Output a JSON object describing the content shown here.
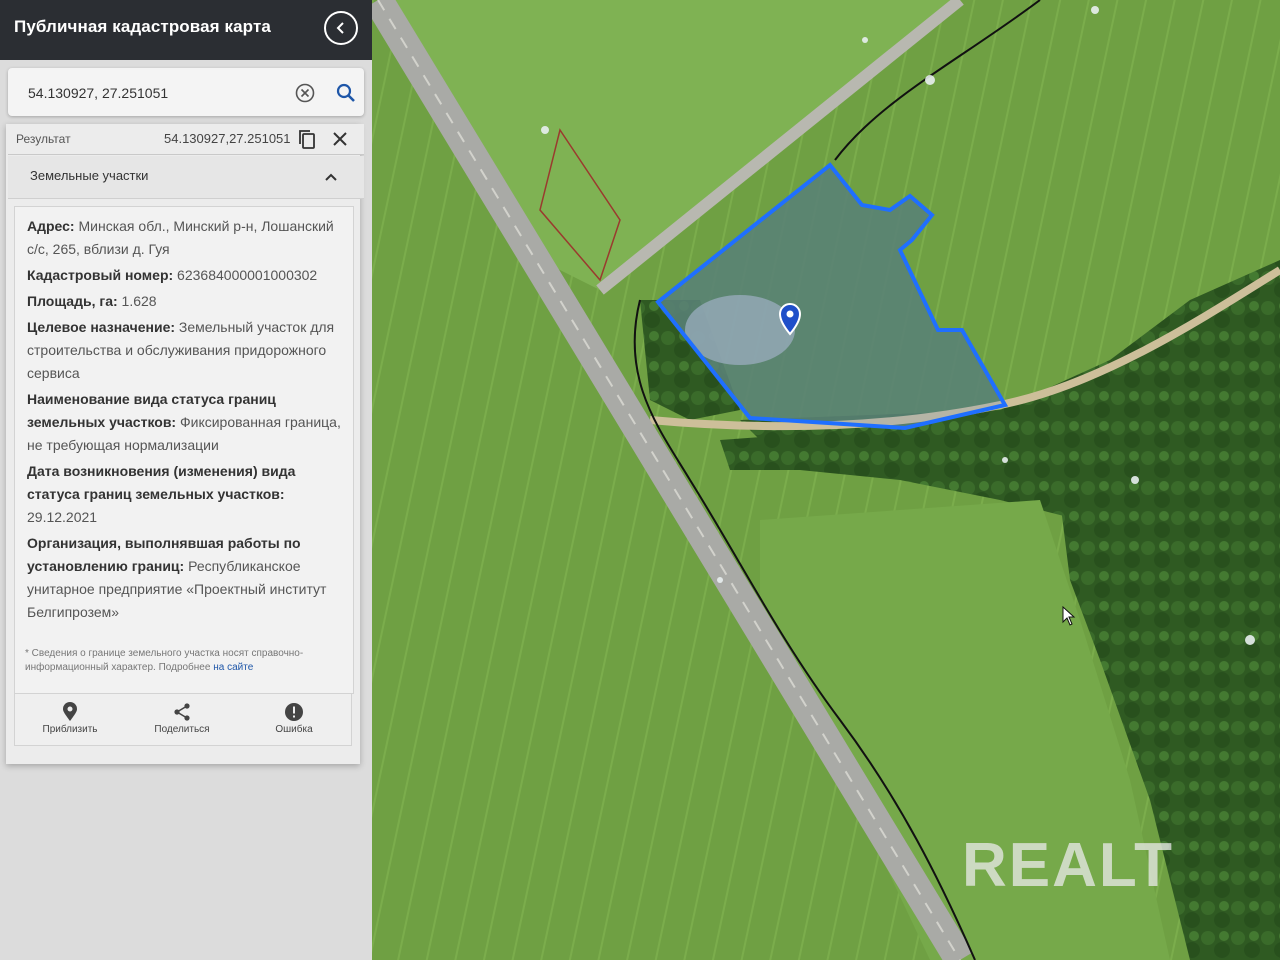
{
  "app": {
    "title": "Публичная кадастровая карта"
  },
  "search": {
    "value": "54.130927, 27.251051"
  },
  "result": {
    "label": "Результат",
    "coords": "54.130927,27.251051"
  },
  "section": {
    "title": "Земельные участки"
  },
  "parcel": {
    "address_label": "Адрес:",
    "address_value": " Минская обл., Минский р-н, Лошанский с/с, 265, вблизи д. Гуя",
    "cadastral_label": "Кадастровый номер:",
    "cadastral_value": " 623684000001000302",
    "area_label": "Площадь, га:",
    "area_value": " 1.628",
    "purpose_label": "Целевое назначение:",
    "purpose_value": " Земельный участок для строительства и обслуживания придорожного сервиса",
    "boundary_status_label": "Наименование вида статуса границ земельных участков:",
    "boundary_status_value": " Фиксированная граница, не требующая нормализации",
    "date_label": "Дата возникновения (изменения) вида статуса границ земельных участков:",
    "date_value": " 29.12.2021",
    "org_label": "Организация, выполнявшая работы по установлению границ:",
    "org_value": " Республиканское унитарное предприятие «Проектный институт Белгипрозем»"
  },
  "note": {
    "text": "* Сведения о границе земельного участка носят справочно-информационный характер. Подробнее ",
    "link": "на сайте"
  },
  "actions": {
    "zoom": "Приблизить",
    "share": "Поделиться",
    "error": "Ошибка"
  },
  "watermark": "REALT",
  "colors": {
    "parcel_outline": "#1f6fff",
    "sidebar_header": "#2b2e33",
    "link": "#1e56a8"
  }
}
